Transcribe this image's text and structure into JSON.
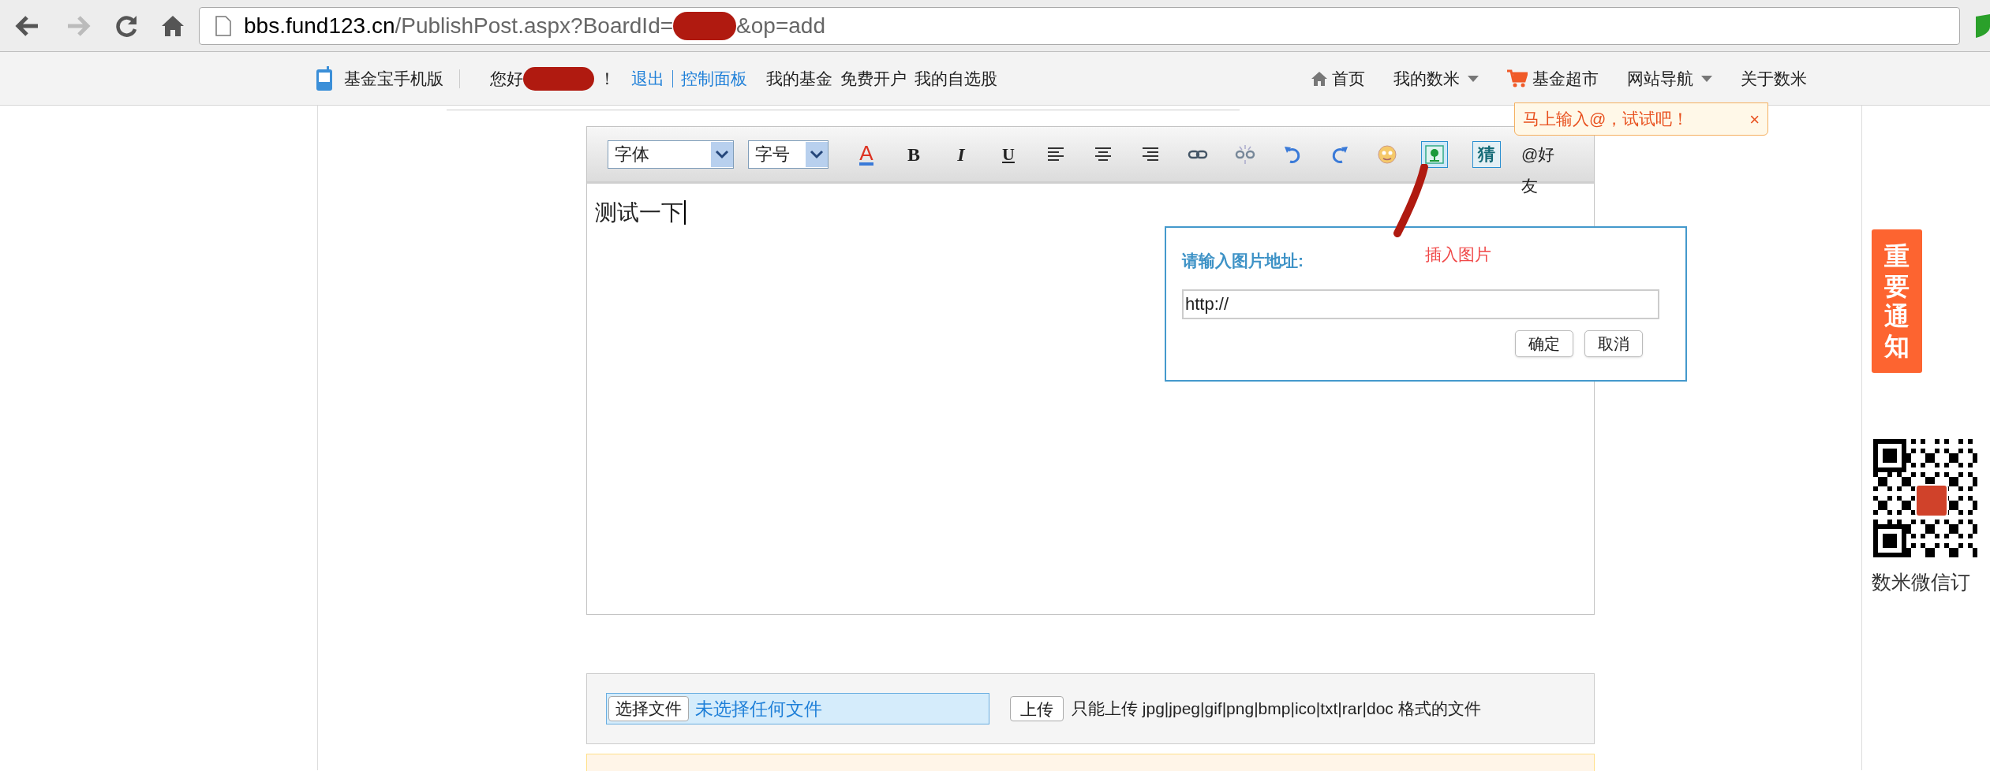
{
  "browser": {
    "url_host": "bbs.fund123.cn",
    "url_path": "/PublishPost.aspx?BoardId=",
    "url_tail": "&op=add"
  },
  "top_nav": {
    "mobile_link": "基金宝手机版",
    "greeting": "您好",
    "greeting_end": "！",
    "account_links": [
      "退出",
      "控制面板"
    ],
    "links": [
      "我的基金",
      "免费开户",
      "我的自选股"
    ],
    "right_menu": [
      {
        "label": "首页",
        "kind": "home"
      },
      {
        "label": "我的数米",
        "kind": "dropdown"
      },
      {
        "label": "基金超市",
        "kind": "cart"
      },
      {
        "label": "网站导航",
        "kind": "dropdown"
      },
      {
        "label": "关于数米",
        "kind": "plain"
      }
    ]
  },
  "editor": {
    "toolbar": [
      {
        "kind": "select",
        "label": "字体"
      },
      {
        "kind": "select",
        "label": "字号"
      },
      {
        "kind": "font_color",
        "label": "A",
        "active": false
      },
      {
        "kind": "bold",
        "label": "B",
        "active": false
      },
      {
        "kind": "italic",
        "label": "I",
        "active": false
      },
      {
        "kind": "underline",
        "label": "U",
        "active": false
      },
      {
        "kind": "align_left",
        "active": false
      },
      {
        "kind": "align_center",
        "active": false
      },
      {
        "kind": "align_right",
        "active": false
      },
      {
        "kind": "link",
        "active": false
      },
      {
        "kind": "unlink",
        "active": false
      },
      {
        "kind": "undo",
        "active": false
      },
      {
        "kind": "redo",
        "active": false
      },
      {
        "kind": "emoticon",
        "active": false
      },
      {
        "kind": "image",
        "active": true
      },
      {
        "kind": "guess",
        "label": "猜",
        "active": false
      },
      {
        "kind": "mention",
        "label": "@好友"
      }
    ],
    "content": "测试一下"
  },
  "mention_tip": {
    "text": "马上输入@，试试吧！",
    "close": "×"
  },
  "image_dialog": {
    "title": "请输入图片地址:",
    "value": "http://",
    "buttons": [
      "确定",
      "取消"
    ]
  },
  "annotation": {
    "text": "插入图片"
  },
  "upload": {
    "choose_button": "选择文件",
    "file_status": "未选择任何文件",
    "upload_button": "上传",
    "hint": "只能上传 jpg|jpeg|gif|png|bmp|ico|txt|rar|doc 格式的文件"
  },
  "notice_button": "重要通知",
  "qr_caption": "数米微信订"
}
